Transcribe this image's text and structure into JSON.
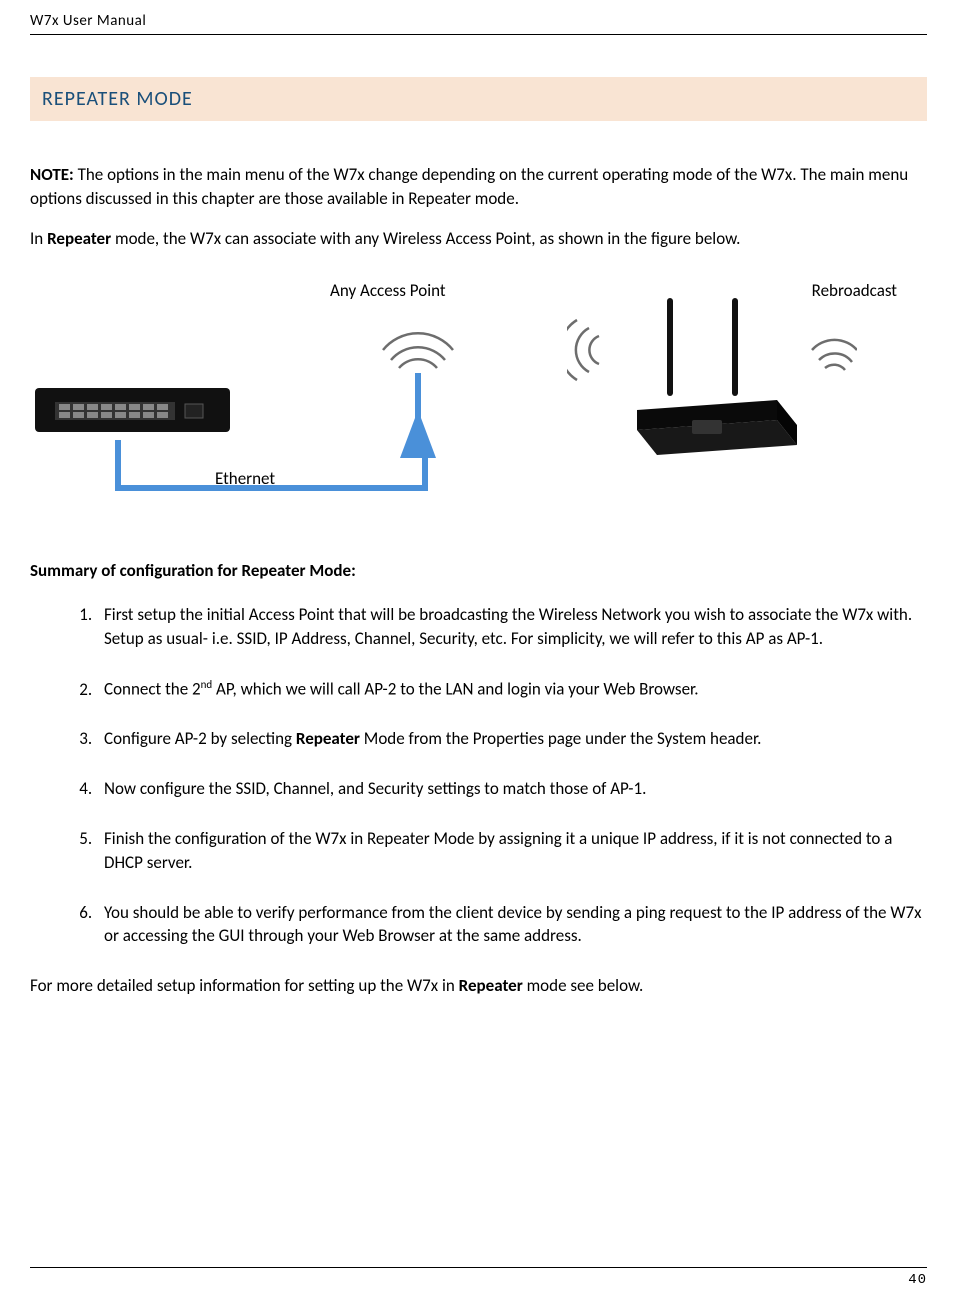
{
  "header": "W7x  User Manual",
  "section_title": "REPEATER MODE",
  "note_para": {
    "prefix": "NOTE:",
    "rest": " The options in the main menu of the W7x change depending on the current operating mode of the W7x. The main menu options discussed in this chapter are those available in Repeater mode."
  },
  "intro_para": {
    "p1": "In ",
    "bold": "Repeater",
    "p2": " mode, the W7x can associate with any Wireless Access Point, as shown in the figure below."
  },
  "diagram": {
    "access_point_label": "Any Access Point",
    "rebroadcast_label": "Rebroadcast",
    "ethernet_label": "Ethernet"
  },
  "summary_heading": "Summary of configuration for Repeater Mode:",
  "steps": {
    "s1": "First setup the initial Access Point that will be broadcasting the Wireless Network you wish to associate the W7x with.  Setup as usual- i.e. SSID, IP Address, Channel, Security, etc. For simplicity, we will refer to this AP as AP-1.",
    "s2a": "Connect the 2",
    "s2sup": "nd",
    "s2b": " AP, which we will call AP-2 to the LAN and login via your Web Browser.",
    "s3a": "Configure AP-2 by selecting ",
    "s3bold": "Repeater",
    "s3b": " Mode from the Properties page under the System header.",
    "s4": "Now configure the SSID, Channel, and Security settings to match those of AP-1.",
    "s5": "Finish the configuration of the W7x in Repeater Mode by assigning it a unique IP address, if it is not connected to a DHCP server.",
    "s6": "You should be able to verify performance from the client device by sending a ping request to the IP address of the W7x or accessing the GUI through your Web Browser at the same address."
  },
  "closing": {
    "p1": "For more detailed setup information for setting up the W7x in ",
    "bold": "Repeater",
    "p2": " mode see below."
  },
  "page_number": "40"
}
